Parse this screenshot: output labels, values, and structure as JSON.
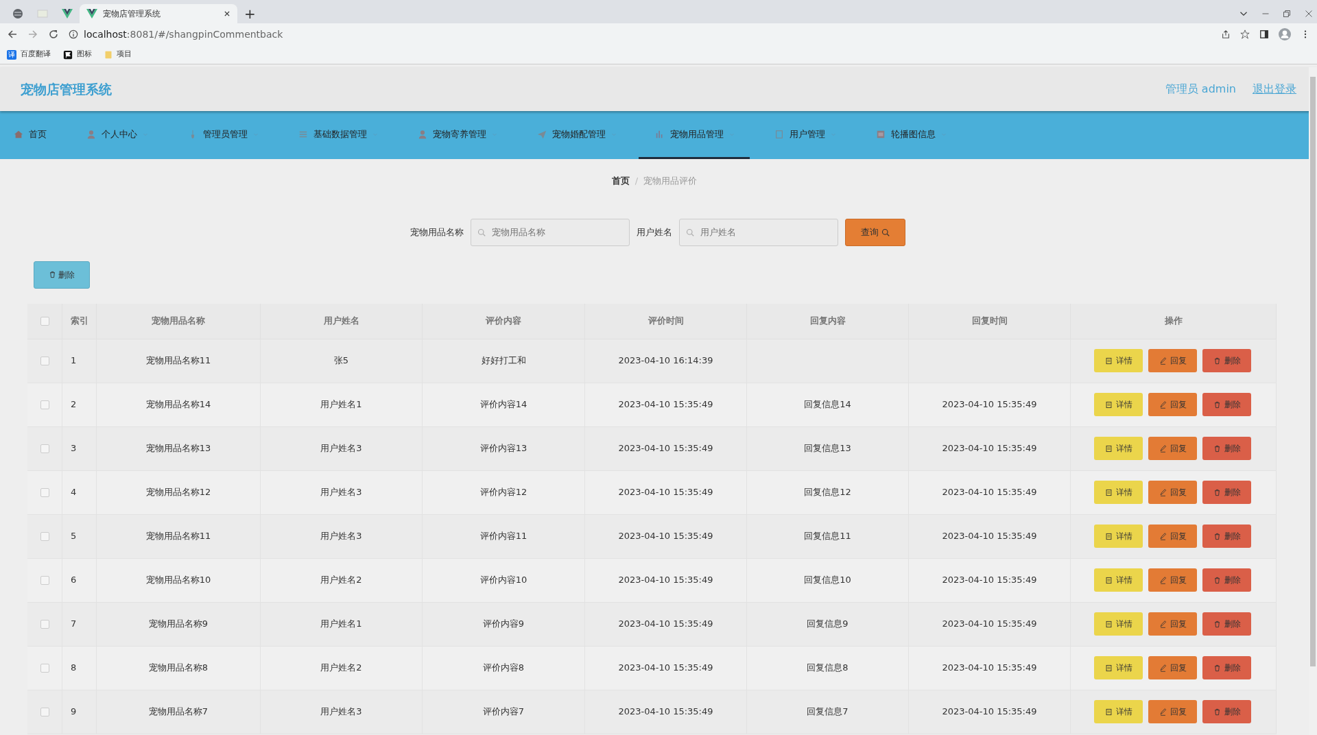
{
  "browser": {
    "tabs": [
      {
        "kind": "globe",
        "selected": false
      },
      {
        "kind": "blank",
        "selected": false
      },
      {
        "kind": "vue",
        "selected": false
      },
      {
        "kind": "vue",
        "title": "宠物店管理系统",
        "selected": true
      }
    ],
    "new_tab": "+",
    "url_host": "localhost",
    "url_rest": ":8081/#/shangpinCommentback",
    "bookmarks": [
      {
        "kind": "translate",
        "label": "百度翻译",
        "badge": "译"
      },
      {
        "kind": "flag",
        "label": "图标"
      },
      {
        "kind": "folder",
        "label": "项目"
      }
    ]
  },
  "app": {
    "title": "宠物店管理系统",
    "user": "管理员 admin",
    "logout": "退出登录"
  },
  "nav": [
    {
      "label": "首页",
      "selected": false,
      "dropdown": false
    },
    {
      "label": "个人中心",
      "selected": false,
      "dropdown": true
    },
    {
      "label": "管理员管理",
      "selected": false,
      "dropdown": true
    },
    {
      "label": "基础数据管理",
      "selected": false,
      "dropdown": true
    },
    {
      "label": "宠物寄养管理",
      "selected": false,
      "dropdown": true
    },
    {
      "label": "宠物婚配管理",
      "selected": false,
      "dropdown": true
    },
    {
      "label": "宠物用品管理",
      "selected": true,
      "dropdown": true
    },
    {
      "label": "用户管理",
      "selected": false,
      "dropdown": true
    },
    {
      "label": "轮播图信息",
      "selected": false,
      "dropdown": true
    }
  ],
  "breadcrumb": [
    {
      "label": "首页"
    },
    {
      "label": "宠物用品评价",
      "separator": "/"
    }
  ],
  "search": {
    "fields": [
      {
        "label": "宠物用品名称",
        "placeholder": "宠物用品名称"
      },
      {
        "label": "用户姓名",
        "placeholder": "用户姓名"
      }
    ],
    "button": "查询"
  },
  "bulk_delete": "删除",
  "table": {
    "header_checked": false,
    "columns": [
      "索引",
      "宠物用品名称",
      "用户姓名",
      "评价内容",
      "评价时间",
      "回复内容",
      "回复时间",
      "操作"
    ],
    "rows": [
      {
        "checked": false,
        "cells": [
          "1",
          "宠物用品名称11",
          "张5",
          "好好打工和",
          "2023-04-10 16:14:39",
          "",
          ""
        ],
        "actions": [
          "详情",
          "回复",
          "删除"
        ]
      },
      {
        "checked": false,
        "cells": [
          "2",
          "宠物用品名称14",
          "用户姓名1",
          "评价内容14",
          "2023-04-10 15:35:49",
          "回复信息14",
          "2023-04-10 15:35:49"
        ],
        "actions": [
          "详情",
          "回复",
          "删除"
        ]
      },
      {
        "checked": false,
        "cells": [
          "3",
          "宠物用品名称13",
          "用户姓名3",
          "评价内容13",
          "2023-04-10 15:35:49",
          "回复信息13",
          "2023-04-10 15:35:49"
        ],
        "actions": [
          "详情",
          "回复",
          "删除"
        ]
      },
      {
        "checked": false,
        "cells": [
          "4",
          "宠物用品名称12",
          "用户姓名3",
          "评价内容12",
          "2023-04-10 15:35:49",
          "回复信息12",
          "2023-04-10 15:35:49"
        ],
        "actions": [
          "详情",
          "回复",
          "删除"
        ]
      },
      {
        "checked": false,
        "cells": [
          "5",
          "宠物用品名称11",
          "用户姓名3",
          "评价内容11",
          "2023-04-10 15:35:49",
          "回复信息11",
          "2023-04-10 15:35:49"
        ],
        "actions": [
          "详情",
          "回复",
          "删除"
        ]
      },
      {
        "checked": false,
        "cells": [
          "6",
          "宠物用品名称10",
          "用户姓名2",
          "评价内容10",
          "2023-04-10 15:35:49",
          "回复信息10",
          "2023-04-10 15:35:49"
        ],
        "actions": [
          "详情",
          "回复",
          "删除"
        ]
      },
      {
        "checked": false,
        "cells": [
          "7",
          "宠物用品名称9",
          "用户姓名1",
          "评价内容9",
          "2023-04-10 15:35:49",
          "回复信息9",
          "2023-04-10 15:35:49"
        ],
        "actions": [
          "详情",
          "回复",
          "删除"
        ]
      },
      {
        "checked": false,
        "cells": [
          "8",
          "宠物用品名称8",
          "用户姓名2",
          "评价内容8",
          "2023-04-10 15:35:49",
          "回复信息8",
          "2023-04-10 15:35:49"
        ],
        "actions": [
          "详情",
          "回复",
          "删除"
        ]
      },
      {
        "checked": false,
        "cells": [
          "9",
          "宠物用品名称7",
          "用户姓名3",
          "评价内容7",
          "2023-04-10 15:35:49",
          "回复信息7",
          "2023-04-10 15:35:49"
        ],
        "actions": [
          "详情",
          "回复",
          "删除"
        ]
      }
    ]
  }
}
